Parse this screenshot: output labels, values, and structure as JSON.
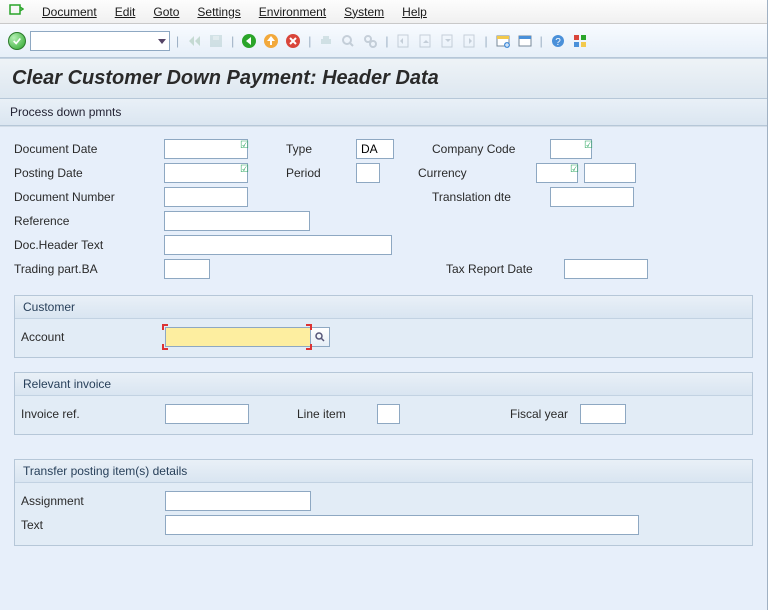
{
  "menu": {
    "items": [
      "Document",
      "Edit",
      "Goto",
      "Settings",
      "Environment",
      "System",
      "Help"
    ]
  },
  "title": "Clear Customer Down Payment: Header Data",
  "subbar": "Process down pmnts",
  "fields": {
    "documentDate": "Document Date",
    "postingDate": "Posting Date",
    "documentNumber": "Document Number",
    "reference": "Reference",
    "docHeaderText": "Doc.Header Text",
    "tradingPartBA": "Trading part.BA",
    "type": "Type",
    "typeValue": "DA",
    "period": "Period",
    "companyCode": "Company Code",
    "currency": "Currency",
    "translationDte": "Translation dte",
    "taxReportDate": "Tax Report Date"
  },
  "groups": {
    "customer": {
      "title": "Customer",
      "account": "Account"
    },
    "invoice": {
      "title": "Relevant invoice",
      "invoiceRef": "Invoice ref.",
      "lineItem": "Line item",
      "fiscalYear": "Fiscal year"
    },
    "transfer": {
      "title": "Transfer posting item(s) details",
      "assignment": "Assignment",
      "text": "Text"
    }
  }
}
